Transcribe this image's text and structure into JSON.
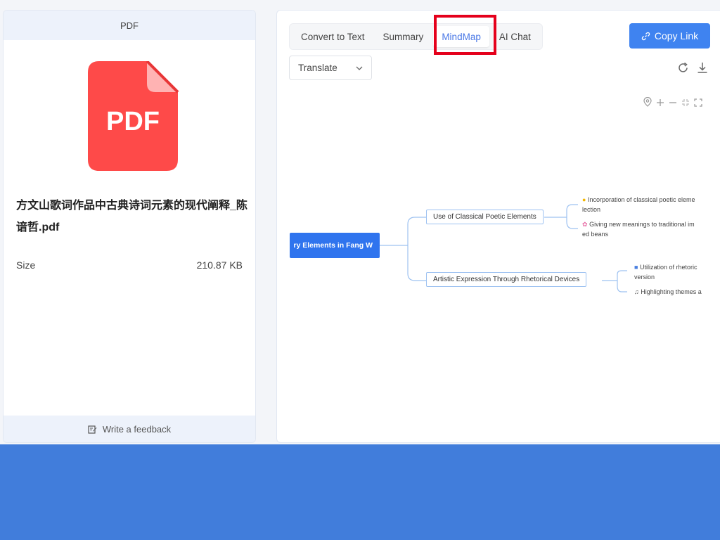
{
  "left": {
    "header": "PDF",
    "pdf_icon_text": "PDF",
    "file_name": "方文山歌词作品中古典诗词元素的现代阐释_陈谙哲.pdf",
    "size_label": "Size",
    "size_value": "210.87 KB",
    "feedback_label": "Write a feedback"
  },
  "toolbar": {
    "tabs": [
      {
        "label": "Convert to Text",
        "active": false
      },
      {
        "label": "Summary",
        "active": false
      },
      {
        "label": "MindMap",
        "active": true
      },
      {
        "label": "AI Chat",
        "active": false
      }
    ],
    "copy_link_label": "Copy Link",
    "translate_label": "Translate"
  },
  "mindmap": {
    "root": "ry Elements in Fang W",
    "branches": [
      {
        "label": "Use of Classical Poetic Elements",
        "leaves": [
          {
            "icon": "lightbulb-icon",
            "text": "Incorporation of classical poetic eleme",
            "text2": "lection"
          },
          {
            "icon": "flower-icon",
            "text": "Giving new meanings to traditional im",
            "text2": "ed beans"
          }
        ]
      },
      {
        "label": "Artistic Expression Through Rhetorical Devices",
        "leaves": [
          {
            "icon": "palette-icon",
            "text": "Utilization of rhetoric",
            "text2": "version"
          },
          {
            "icon": "music-icon",
            "text": "Highlighting themes a",
            "text2": ""
          }
        ]
      }
    ]
  },
  "colors": {
    "accent": "#3f83f0",
    "pdf_red": "#fe4a49",
    "highlight_box": "#e5001b",
    "bottom_band": "#417ddb"
  }
}
